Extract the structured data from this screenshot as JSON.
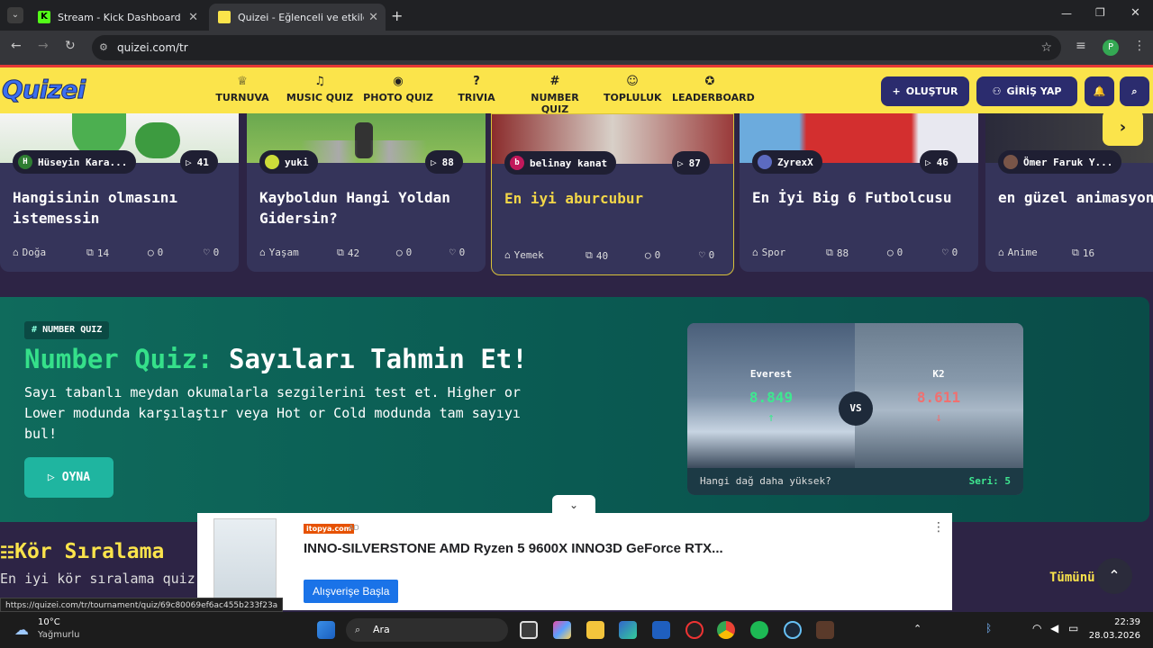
{
  "browser": {
    "tabs": [
      {
        "title": "Stream - Kick Dashboard",
        "active": false
      },
      {
        "title": "Quizei - Eğlenceli ve etkileşimli",
        "active": true
      }
    ],
    "url": "quizei.com/tr",
    "profile_initial": "P"
  },
  "header": {
    "logo": "Quizei",
    "nav": [
      {
        "label": "TURNUVA",
        "icon": "trophy-icon"
      },
      {
        "label": "MUSIC QUIZ",
        "icon": "music-icon"
      },
      {
        "label": "PHOTO QUIZ",
        "icon": "camera-icon"
      },
      {
        "label": "TRIVIA",
        "icon": "question-icon"
      },
      {
        "label": "NUMBER QUIZ",
        "icon": "hash-icon"
      },
      {
        "label": "TOPLULUK",
        "icon": "users-icon"
      },
      {
        "label": "LEADERBOARD",
        "icon": "award-icon"
      }
    ],
    "create_label": "OLUŞTUR",
    "login_label": "GİRİŞ YAP"
  },
  "cards": [
    {
      "author": "Hüseyin Kara...",
      "author_initial": "H",
      "plays": "41",
      "title": "Hangisinin olmasını istemessin",
      "category": "Doğa",
      "items": "14",
      "comments": "0",
      "likes": "0"
    },
    {
      "author": "yuki",
      "author_initial": "",
      "plays": "88",
      "title": "Kayboldun Hangi Yoldan Gidersin?",
      "category": "Yaşam",
      "items": "42",
      "comments": "0",
      "likes": "0"
    },
    {
      "author": "belinay kanat",
      "author_initial": "b",
      "plays": "87",
      "title": "En iyi aburcubur",
      "category": "Yemek",
      "items": "40",
      "comments": "0",
      "likes": "0"
    },
    {
      "author": "ZyrexX",
      "author_initial": "",
      "plays": "46",
      "title": "En İyi Big 6 Futbolcusu",
      "category": "Spor",
      "items": "88",
      "comments": "0",
      "likes": "0"
    },
    {
      "author": "Ömer Faruk Y...",
      "author_initial": "",
      "plays": "",
      "title": "en güzel animasyon karakteri",
      "category": "Anime",
      "items": "16",
      "comments": "",
      "likes": ""
    }
  ],
  "number_quiz": {
    "badge": "NUMBER QUIZ",
    "title_accent": "Number Quiz:",
    "title_rest": "Sayıları Tahmin Et!",
    "description": "Sayı tabanlı meydan okumalarla sezgilerini test et. Higher or Lower modunda karşılaştır veya Hot or Cold modunda tam sayıyı bul!",
    "play_label": "OYNA",
    "game": {
      "left_name": "Everest",
      "left_value": "8.849",
      "right_name": "K2",
      "right_value": "8.611",
      "vs": "VS",
      "question": "Hangi dağ daha yüksek?",
      "streak": "Seri: 5"
    }
  },
  "blind_ranking": {
    "title": "Kör Sıralama",
    "subtitle": "En iyi kör sıralama quiz",
    "see_all": "Tümünü"
  },
  "ad": {
    "brand": "itopya.com",
    "tag": "AD",
    "title": "INNO-SILVERSTONE AMD Ryzen 5 9600X INNO3D GeForce RTX...",
    "cta": "Alışverişe Başla"
  },
  "status_url": "https://quizei.com/tr/tournament/quiz/69c80069ef6ac455b233f23a",
  "taskbar": {
    "weather_temp": "10°C",
    "weather_desc": "Yağmurlu",
    "search": "Ara",
    "time": "22:39",
    "date": "28.03.2026"
  }
}
